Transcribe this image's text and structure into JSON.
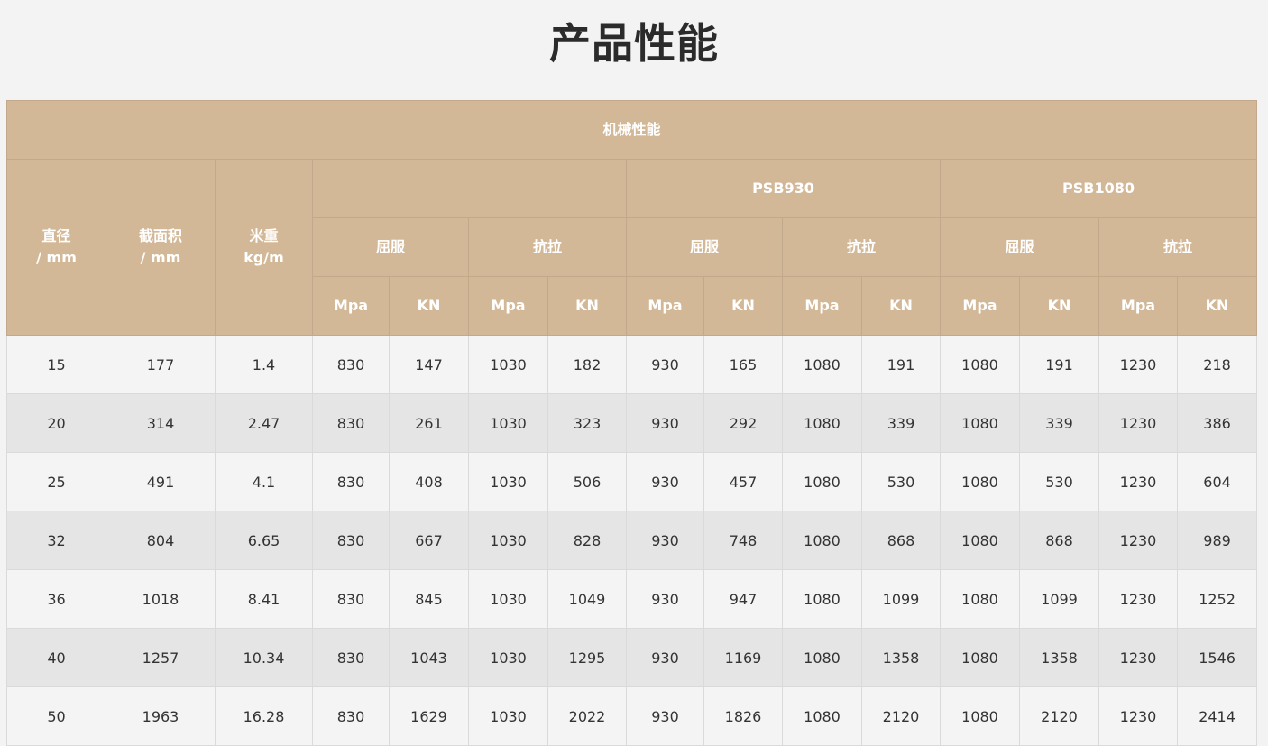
{
  "page": {
    "title": "产品性能"
  },
  "table": {
    "main_header": "机械性能",
    "col_diameter": [
      "直径",
      "/ mm"
    ],
    "col_area": [
      "截面积",
      "/ mm"
    ],
    "col_weight": [
      "米重",
      "kg/m"
    ],
    "groups": [
      "",
      "PSB930",
      "PSB1080"
    ],
    "subgroups": [
      "屈服",
      "抗拉",
      "屈服",
      "抗拉",
      "屈服",
      "抗拉"
    ],
    "units": [
      "Mpa",
      "KN",
      "Mpa",
      "KN",
      "Mpa",
      "KN",
      "Mpa",
      "KN",
      "Mpa",
      "KN",
      "Mpa",
      "KN"
    ],
    "rows": [
      [
        "15",
        "177",
        "1.4",
        "830",
        "147",
        "1030",
        "182",
        "930",
        "165",
        "1080",
        "191",
        "1080",
        "191",
        "1230",
        "218"
      ],
      [
        "20",
        "314",
        "2.47",
        "830",
        "261",
        "1030",
        "323",
        "930",
        "292",
        "1080",
        "339",
        "1080",
        "339",
        "1230",
        "386"
      ],
      [
        "25",
        "491",
        "4.1",
        "830",
        "408",
        "1030",
        "506",
        "930",
        "457",
        "1080",
        "530",
        "1080",
        "530",
        "1230",
        "604"
      ],
      [
        "32",
        "804",
        "6.65",
        "830",
        "667",
        "1030",
        "828",
        "930",
        "748",
        "1080",
        "868",
        "1080",
        "868",
        "1230",
        "989"
      ],
      [
        "36",
        "1018",
        "8.41",
        "830",
        "845",
        "1030",
        "1049",
        "930",
        "947",
        "1080",
        "1099",
        "1080",
        "1099",
        "1230",
        "1252"
      ],
      [
        "40",
        "1257",
        "10.34",
        "830",
        "1043",
        "1030",
        "1295",
        "930",
        "1169",
        "1080",
        "1358",
        "1080",
        "1358",
        "1230",
        "1546"
      ],
      [
        "50",
        "1963",
        "16.28",
        "830",
        "1629",
        "1030",
        "2022",
        "930",
        "1826",
        "1080",
        "2120",
        "1080",
        "2120",
        "1230",
        "2414"
      ]
    ]
  }
}
